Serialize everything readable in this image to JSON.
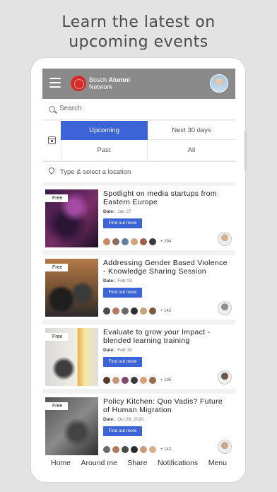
{
  "promo": {
    "line1": "Learn the latest on",
    "line2": "upcoming events"
  },
  "app": {
    "brand_line1": "Bosch",
    "brand_bold": "Alumni",
    "brand_line2": "Network",
    "accent_color": "#3d63d9",
    "logo_color": "#d52b2b"
  },
  "search": {
    "placeholder": "Search"
  },
  "filters": {
    "tabs": [
      {
        "label": "Upcoming",
        "active": true
      },
      {
        "label": "Next 30 days",
        "active": false
      },
      {
        "label": "Past",
        "active": false
      },
      {
        "label": "All",
        "active": false
      }
    ]
  },
  "location": {
    "placeholder": "Type & select a location"
  },
  "events": [
    {
      "badge": "Free",
      "title": "Spotlight on media startups from Eastern Europe",
      "date_label": "Date:",
      "date": "Jan 27",
      "button": "Find out more",
      "attendee_count": "+ 294",
      "attendee_colors": [
        "#c48a6a",
        "#8b6b5a",
        "#5f7f9e",
        "#d9a37a",
        "#a05e46",
        "#3b3b3b"
      ],
      "host_color": "#d7b08e"
    },
    {
      "badge": "Free",
      "title": "Addressing Gender Based Violence - Knowledge Sharing Session",
      "date_label": "Date:",
      "date": "Feb 03",
      "button": "Find out more",
      "attendee_count": "+ 142",
      "attendee_colors": [
        "#4a4a4a",
        "#b67b5d",
        "#6a6a6a",
        "#2f2f2f",
        "#c9a27a",
        "#7a5a3a"
      ],
      "host_color": "#8f8f8f"
    },
    {
      "badge": "Free",
      "title": "Evaluate to grow your Impact - blended learning training",
      "date_label": "Date:",
      "date": "Feb 15",
      "button": "Find out more",
      "attendee_count": "+ 195",
      "attendee_colors": [
        "#5a3a2a",
        "#c9937a",
        "#7a4a6a",
        "#3a3a3a",
        "#d9a07a",
        "#9a6a4a"
      ],
      "host_color": "#6b5a4a"
    },
    {
      "badge": "Free",
      "title": "Policy Kitchen: Quo Vadis? Future of Human Migration",
      "date_label": "Date:",
      "date": "Oct 28, 2020",
      "button": "Find out more",
      "attendee_count": "+ 142",
      "attendee_colors": [
        "#6a6a6a",
        "#b07a5a",
        "#4a4a4a",
        "#2a2a2a",
        "#c99a7a",
        "#d9b08e"
      ],
      "host_color": "#c9a88a"
    }
  ],
  "nav": {
    "items": [
      "Home",
      "Around me",
      "Share",
      "Notifications",
      "Menu"
    ]
  }
}
